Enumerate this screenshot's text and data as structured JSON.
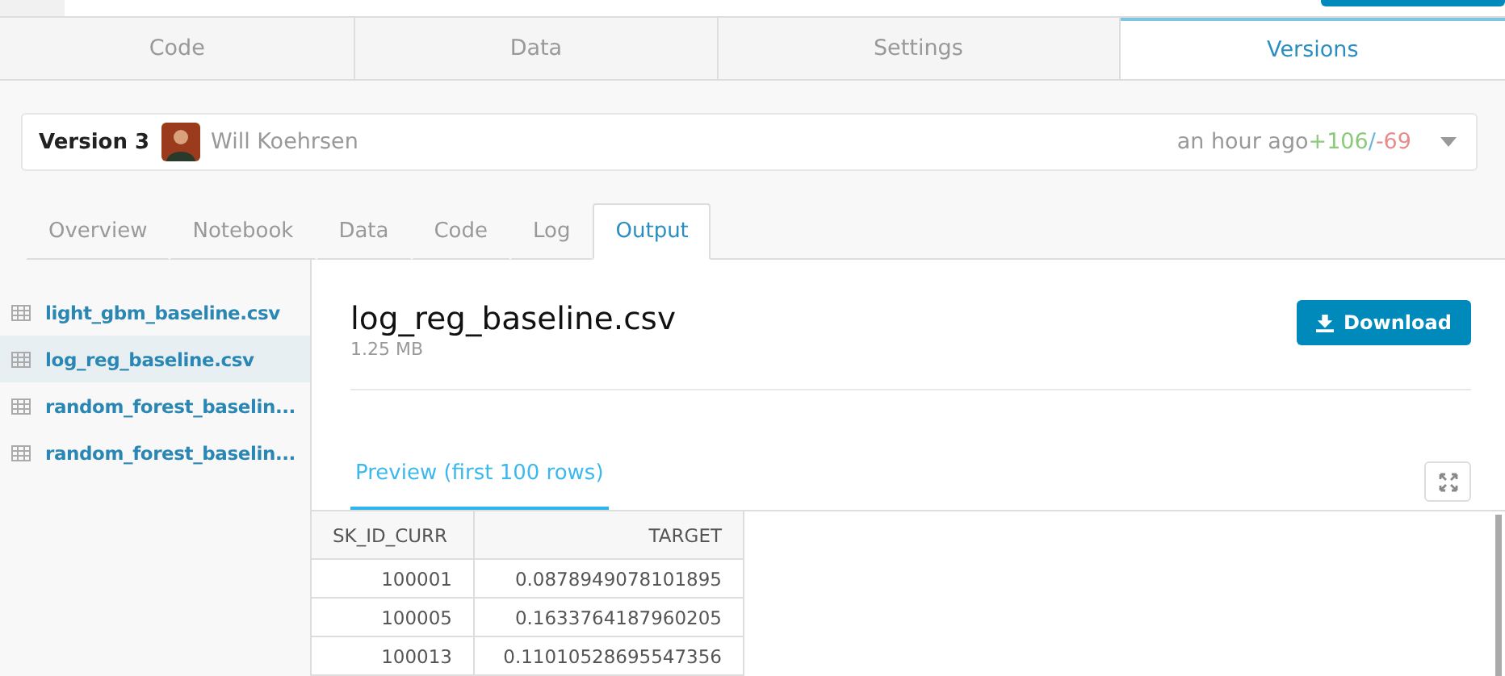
{
  "main_tabs": [
    {
      "label": "Code",
      "selected": false
    },
    {
      "label": "Data",
      "selected": false
    },
    {
      "label": "Settings",
      "selected": false
    },
    {
      "label": "Versions",
      "selected": true
    }
  ],
  "version_bar": {
    "version": "Version 3",
    "author": "Will Koehrsen",
    "time": "an hour ago",
    "added": "+106",
    "separator": "/",
    "removed": "-69"
  },
  "sub_tabs": [
    {
      "label": "Overview",
      "selected": false
    },
    {
      "label": "Notebook",
      "selected": false
    },
    {
      "label": "Data",
      "selected": false
    },
    {
      "label": "Code",
      "selected": false
    },
    {
      "label": "Log",
      "selected": false
    },
    {
      "label": "Output",
      "selected": true
    }
  ],
  "sidebar": {
    "items": [
      {
        "label": "light_gbm_baseline.csv",
        "selected": false
      },
      {
        "label": "log_reg_baseline.csv",
        "selected": true
      },
      {
        "label": "random_forest_baselin...",
        "selected": false
      },
      {
        "label": "random_forest_baselin...",
        "selected": false
      }
    ]
  },
  "file": {
    "name": "log_reg_baseline.csv",
    "size": "1.25 MB",
    "download_label": "Download"
  },
  "preview_tab": {
    "label": "Preview (first 100 rows)",
    "selected": true
  },
  "table": {
    "columns": [
      "SK_ID_CURR",
      "TARGET"
    ],
    "rows": [
      [
        "100001",
        "0.0878949078101895"
      ],
      [
        "100005",
        "0.1633764187960205"
      ],
      [
        "100013",
        "0.11010528695547356"
      ]
    ]
  }
}
